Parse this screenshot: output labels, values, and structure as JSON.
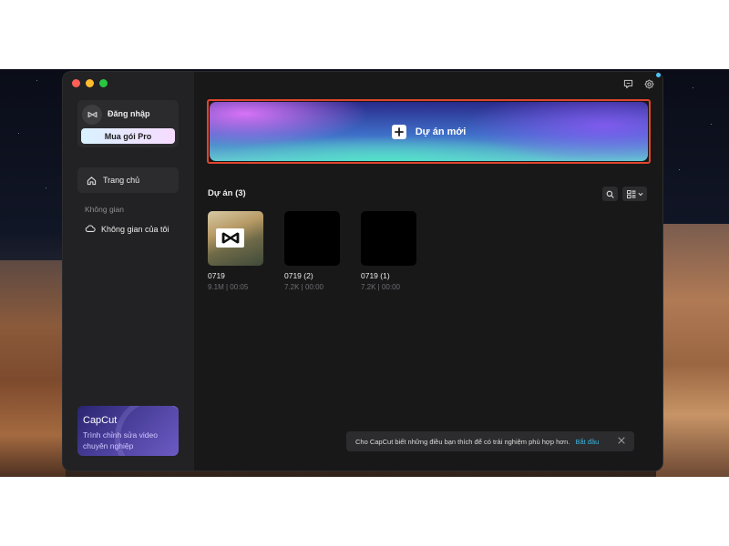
{
  "sidebar": {
    "login_label": "Đăng nhập",
    "pro_button": "Mua gói Pro",
    "home_label": "Trang chủ",
    "space_section": "Không gian",
    "my_space_label": "Không gian của tôi",
    "promo": {
      "brand": "CapCut",
      "description": "Trình chỉnh sửa video chuyên nghiệp"
    }
  },
  "main": {
    "new_project_label": "Dự án mới",
    "projects_header": "Dự án  (3)",
    "projects": [
      {
        "name": "0719",
        "meta": "9.1M | 00:05",
        "thumbnail": "photo"
      },
      {
        "name": "0719 (2)",
        "meta": "7.2K | 00:00",
        "thumbnail": "black"
      },
      {
        "name": "0719 (1)",
        "meta": "7.2K | 00:00",
        "thumbnail": "black"
      }
    ]
  },
  "toast": {
    "text": "Cho CapCut biết những điều bạn thích để có trải nghiệm phù hợp hơn.",
    "link": "Bắt đầu"
  },
  "icons": {
    "feedback": "message-icon",
    "settings": "gear-icon",
    "search": "search-icon",
    "view": "grid-view-icon",
    "home": "home-icon",
    "cloud": "cloud-icon"
  },
  "colors": {
    "accent_link": "#3ab6e0",
    "highlight_border": "#e0452e"
  }
}
